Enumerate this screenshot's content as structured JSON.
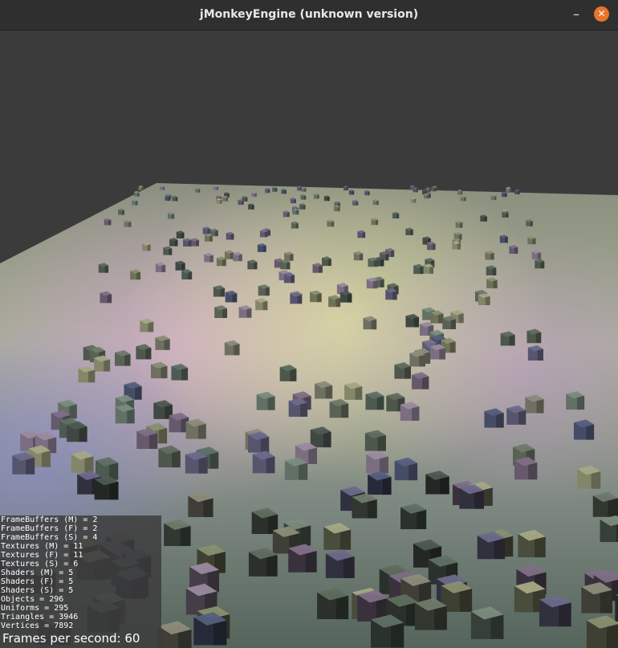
{
  "window": {
    "title": "jMonkeyEngine (unknown version)",
    "minimize_glyph": "–",
    "close_glyph": "✕",
    "close_color": "#e9742b"
  },
  "stats": [
    "FrameBuffers (M) = 2",
    "FrameBuffers (F) = 2",
    "FrameBuffers (S) = 4",
    "Textures (M) = 11",
    "Textures (F) = 11",
    "Textures (S) = 6",
    "Shaders (M) = 5",
    "Shaders (F) = 5",
    "Shaders (S) = 5",
    "Objects = 296",
    "Uniforms = 295",
    "Triangles = 3946",
    "Vertices = 7892"
  ],
  "fps_text": "Frames per second: 60"
}
